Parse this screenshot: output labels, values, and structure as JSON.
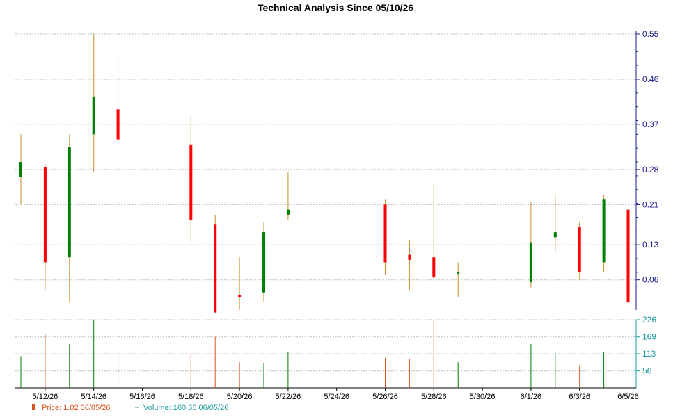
{
  "chart_data": {
    "type": "candlestick",
    "title": "Technical Analysis Since 05/10/26",
    "price_ticks": [
      0.06,
      0.13,
      0.21,
      0.28,
      0.37,
      0.46,
      0.55
    ],
    "volume_ticks": [
      56,
      113,
      169,
      226
    ],
    "x_ticks": [
      "5/12/26",
      "5/14/26",
      "5/16/26",
      "5/18/26",
      "5/20/26",
      "5/22/26",
      "5/24/26",
      "5/26/26",
      "5/28/26",
      "5/30/26",
      "6/1/26",
      "6/3/26",
      "6/5/26"
    ],
    "ylim": [
      0.0,
      0.55
    ],
    "vol_lim": [
      0,
      226
    ],
    "grid": true,
    "colors": {
      "up": "#008000",
      "down": "#ff0000",
      "wick": "#c8902e",
      "grid": "#bbbbbb",
      "axis": "#1a1a8c",
      "vol_axis": "#1a9a9a"
    },
    "candles": [
      {
        "date": "5/11/26",
        "open": 0.265,
        "high": 0.35,
        "low": 0.21,
        "close": 0.295,
        "volume": 105
      },
      {
        "date": "5/12/26",
        "open": 0.285,
        "high": 0.29,
        "low": 0.04,
        "close": 0.095,
        "volume": 180
      },
      {
        "date": "5/13/26",
        "open": 0.105,
        "high": 0.35,
        "low": 0.015,
        "close": 0.325,
        "volume": 145
      },
      {
        "date": "5/14/26",
        "open": 0.35,
        "high": 0.55,
        "low": 0.275,
        "close": 0.425,
        "volume": 226
      },
      {
        "date": "5/15/26",
        "open": 0.4,
        "high": 0.5,
        "low": 0.33,
        "close": 0.34,
        "volume": 100
      },
      {
        "date": "5/18/26",
        "open": 0.33,
        "high": 0.39,
        "low": 0.135,
        "close": 0.18,
        "volume": 110
      },
      {
        "date": "5/19/26",
        "open": 0.17,
        "high": 0.19,
        "low": -0.005,
        "close": -0.005,
        "volume": 170
      },
      {
        "date": "5/20/26",
        "open": 0.03,
        "high": 0.105,
        "low": 0.0,
        "close": 0.025,
        "volume": 85
      },
      {
        "date": "5/21/26",
        "open": 0.035,
        "high": 0.175,
        "low": 0.015,
        "close": 0.155,
        "volume": 82
      },
      {
        "date": "5/22/26",
        "open": 0.19,
        "high": 0.275,
        "low": 0.18,
        "close": 0.2,
        "volume": 118
      },
      {
        "date": "5/26/26",
        "open": 0.21,
        "high": 0.22,
        "low": 0.07,
        "close": 0.095,
        "volume": 100
      },
      {
        "date": "5/27/26",
        "open": 0.11,
        "high": 0.14,
        "low": 0.04,
        "close": 0.1,
        "volume": 95
      },
      {
        "date": "5/28/26",
        "open": 0.105,
        "high": 0.25,
        "low": 0.055,
        "close": 0.065,
        "volume": 226
      },
      {
        "date": "5/29/26",
        "open": 0.075,
        "high": 0.095,
        "low": 0.025,
        "close": 0.075,
        "volume": 85
      },
      {
        "date": "6/1/26",
        "open": 0.055,
        "high": 0.215,
        "low": 0.045,
        "close": 0.135,
        "volume": 145
      },
      {
        "date": "6/2/26",
        "open": 0.145,
        "high": 0.23,
        "low": 0.115,
        "close": 0.155,
        "volume": 110
      },
      {
        "date": "6/3/26",
        "open": 0.165,
        "high": 0.175,
        "low": 0.06,
        "close": 0.075,
        "volume": 75
      },
      {
        "date": "6/4/26",
        "open": 0.095,
        "high": 0.23,
        "low": 0.075,
        "close": 0.22,
        "volume": 118
      },
      {
        "date": "6/5/26",
        "open": 0.2,
        "high": 0.25,
        "low": 0.0,
        "close": 0.015,
        "volume": 160
      }
    ],
    "legend": {
      "price_label": "Price: 1.02  06/05/26",
      "volume_label": "Volume: 160.66  06/05/26"
    }
  }
}
